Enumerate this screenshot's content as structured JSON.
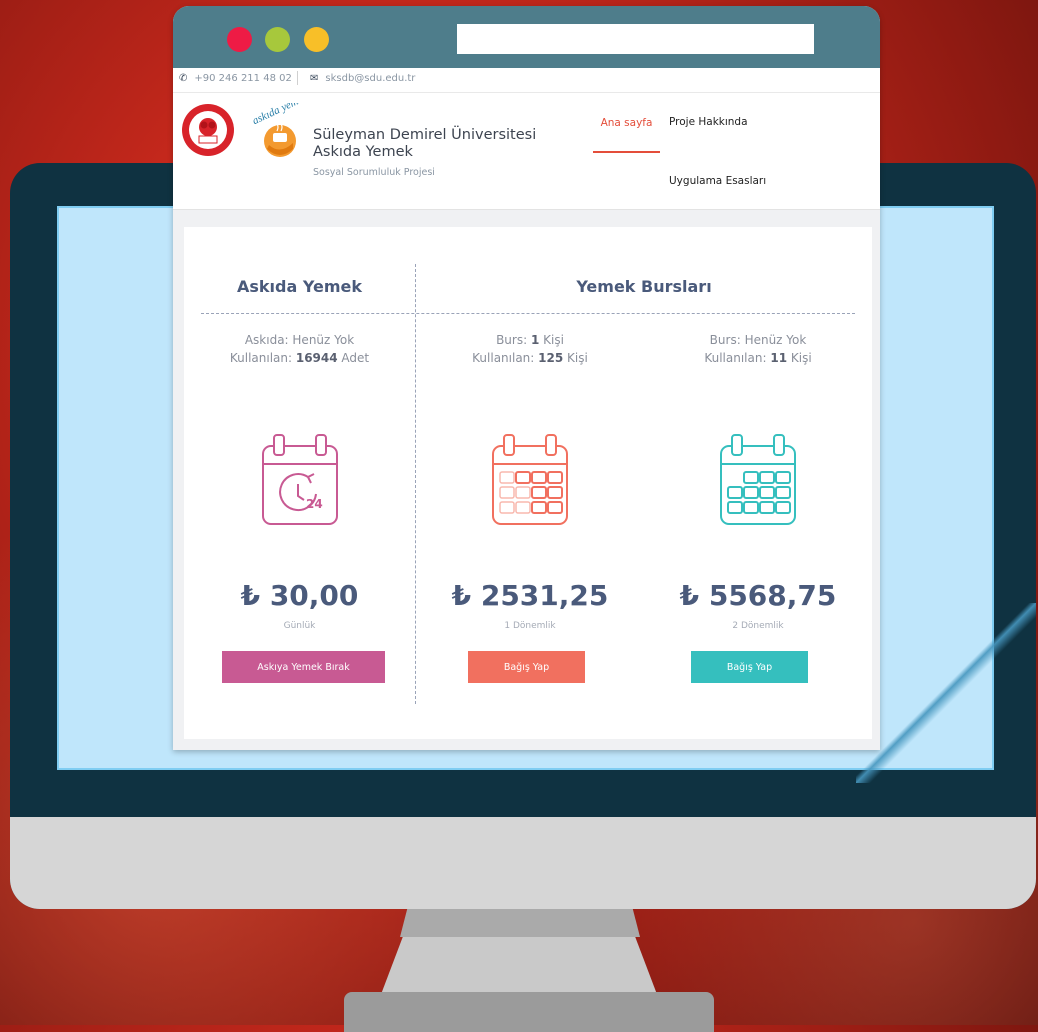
{
  "topbar": {
    "phone_icon": "phone-icon",
    "phone": "+90 246 211 48 02",
    "separator": "|",
    "email_icon": "envelope-icon",
    "email": "sksdb@sdu.edu.tr"
  },
  "header": {
    "title_line1": "Süleyman Demirel Üniversitesi",
    "title_line2": "Askıda Yemek",
    "subtitle": "Sosyal Sorumluluk Projesi",
    "logo_askida_text": "askıda yemek"
  },
  "nav": {
    "home": "Ana sayfa",
    "about": "Proje Hakkında",
    "rules": "Uygulama Esasları"
  },
  "sections": {
    "left_title": "Askıda Yemek",
    "right_title": "Yemek Bursları"
  },
  "columns": [
    {
      "stat1_label": "Askıda: ",
      "stat1_value": "Henüz Yok",
      "stat2_label": "Kullanılan: ",
      "stat2_value": "16944",
      "stat2_unit": " Adet",
      "icon": "calendar-clock-24-icon",
      "icon_badge": "24",
      "price": "₺ 30,00",
      "period": "Günlük",
      "button": "Askıya Yemek Bırak",
      "color": "#c85a93"
    },
    {
      "stat1_label": "Burs: ",
      "stat1_value": "1",
      "stat1_unit": " Kişi",
      "stat2_label": "Kullanılan: ",
      "stat2_value": "125",
      "stat2_unit": " Kişi",
      "icon": "calendar-icon",
      "price": "₺ 2531,25",
      "period": "1 Dönemlik",
      "button": "Bağış Yap",
      "color": "#f1705f"
    },
    {
      "stat1_label": "Burs: ",
      "stat1_value": "Henüz Yok",
      "stat2_label": "Kullanılan: ",
      "stat2_value": "11",
      "stat2_unit": " Kişi",
      "icon": "calendar-icon",
      "price": "₺ 5568,75",
      "period": "2 Dönemlik",
      "button": "Bağış Yap",
      "color": "#35bfbe"
    }
  ],
  "colors": {
    "titlebar": "#4e7d8b",
    "accent": "#e44d3a",
    "heading": "#4a5a7b"
  }
}
